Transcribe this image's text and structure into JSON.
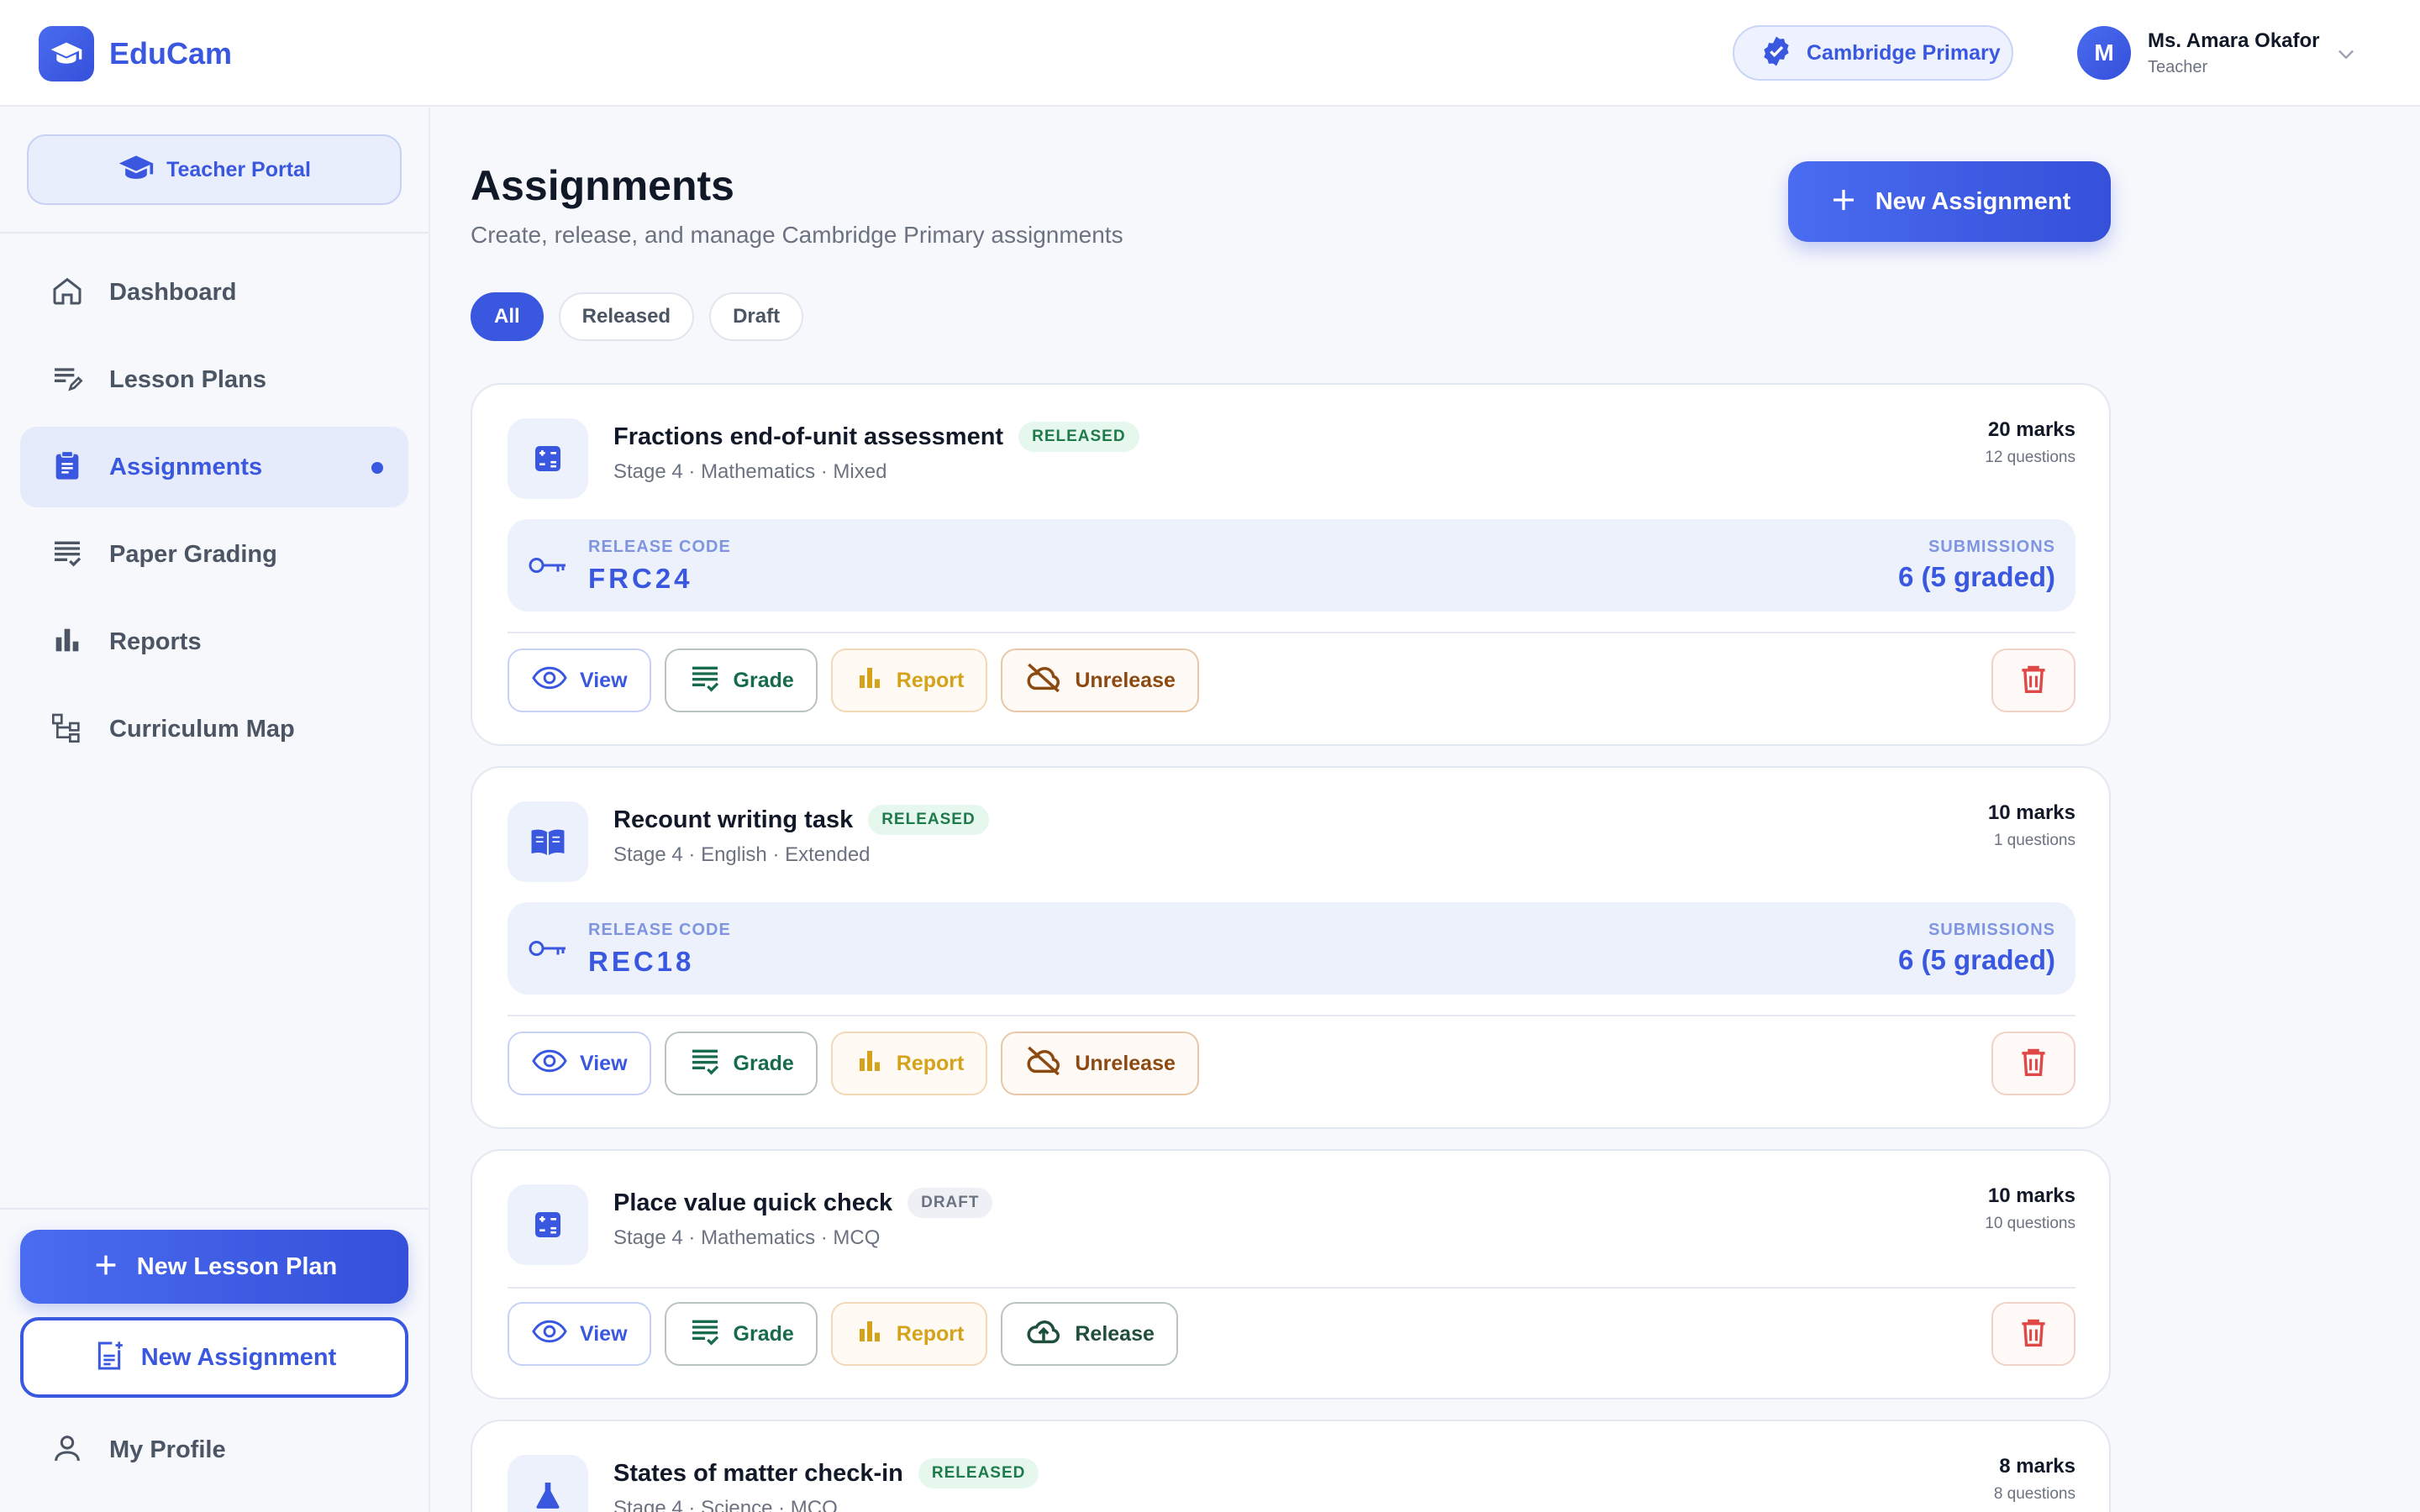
{
  "app": {
    "name": "EduCam"
  },
  "header": {
    "school": "Cambridge Primary",
    "user": {
      "initial": "M",
      "name": "Ms. Amara Okafor",
      "role": "Teacher"
    }
  },
  "sidebar": {
    "portal_label": "Teacher Portal",
    "items": [
      {
        "label": "Dashboard",
        "icon": "home-icon"
      },
      {
        "label": "Lesson Plans",
        "icon": "edit-list-icon"
      },
      {
        "label": "Assignments",
        "icon": "clipboard-icon",
        "active": true
      },
      {
        "label": "Paper Grading",
        "icon": "grading-icon"
      },
      {
        "label": "Reports",
        "icon": "bar-chart-icon"
      },
      {
        "label": "Curriculum Map",
        "icon": "tree-icon"
      }
    ],
    "new_lesson_plan": "New Lesson Plan",
    "new_assignment": "New Assignment",
    "profile": "My Profile"
  },
  "main": {
    "title": "Assignments",
    "subtitle": "Create, release, and manage Cambridge Primary assignments",
    "new_assignment": "New Assignment",
    "filters": [
      "All",
      "Released",
      "Draft"
    ],
    "release_code_label": "RELEASE CODE",
    "submissions_label": "SUBMISSIONS",
    "actions": {
      "view": "View",
      "grade": "Grade",
      "report": "Report",
      "unrelease": "Unrelease",
      "release": "Release"
    },
    "assignments": [
      {
        "title": "Fractions end-of-unit assessment",
        "status": "RELEASED",
        "meta": "Stage 4 · Mathematics · Mixed",
        "marks": "20 marks",
        "questions": "12 questions",
        "code": "FRC24",
        "submissions": "6 (5 graded)",
        "icon": "calculator-icon"
      },
      {
        "title": "Recount writing task",
        "status": "RELEASED",
        "meta": "Stage 4 · English · Extended",
        "marks": "10 marks",
        "questions": "1 questions",
        "code": "REC18",
        "submissions": "6 (5 graded)",
        "icon": "book-icon"
      },
      {
        "title": "Place value quick check",
        "status": "DRAFT",
        "meta": "Stage 4 · Mathematics · MCQ",
        "marks": "10 marks",
        "questions": "10 questions",
        "icon": "calculator-icon"
      },
      {
        "title": "States of matter check-in",
        "status": "RELEASED",
        "meta": "Stage 4 · Science · MCQ",
        "marks": "8 marks",
        "questions": "8 questions",
        "icon": "flask-icon"
      }
    ]
  },
  "colors": {
    "accent": "#3a57e0",
    "released": "#1e7a4a",
    "report": "#d4a21b",
    "danger": "#e04848"
  }
}
